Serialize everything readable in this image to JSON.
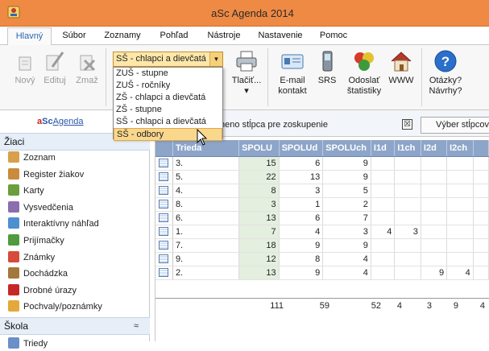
{
  "window": {
    "title": "aSc Agenda 2014"
  },
  "menu": {
    "tabs": [
      {
        "label": "Hlavný",
        "active": true
      },
      {
        "label": "Súbor"
      },
      {
        "label": "Zoznamy"
      },
      {
        "label": "Pohľad"
      },
      {
        "label": "Nástroje"
      },
      {
        "label": "Nastavenie"
      },
      {
        "label": "Pomoc"
      }
    ]
  },
  "ribbon": {
    "new_label": "Nový",
    "edit_label": "Edituj",
    "delete_label": "Zmaž",
    "print_label": "Tlačiť...",
    "print_arrow": "▾",
    "email_label_1": "E-mail",
    "email_label_2": "kontakt",
    "srs_label": "SRS",
    "stats_label_1": "Odoslať",
    "stats_label_2": "štatistiky",
    "www_label": "WWW",
    "help_label_1": "Otázky?",
    "help_label_2": "Návrhy?"
  },
  "combo": {
    "selected": "SŠ - chlapci a dievčatá",
    "options": [
      "ZUŠ - stupne",
      "ZUŠ - ročníky",
      "ZŠ - chlapci a dievčatá",
      "ZŠ - stupne",
      "SŠ - chlapci a dievčatá",
      "SŠ - odbory"
    ],
    "highlighted_index": 5
  },
  "left_panel": {
    "logo_a": "a",
    "logo_sc": "Sc",
    "logo_agenda": "Agenda",
    "section_ziaci": "Žiaci",
    "collapse_symbol": "≈",
    "items": [
      {
        "label": "Zoznam",
        "icon": "people-icon",
        "color": "#d8a04a"
      },
      {
        "label": "Register žiakov",
        "icon": "register-icon",
        "color": "#c98c3c"
      },
      {
        "label": "Karty",
        "icon": "cards-icon",
        "color": "#6b9e3c"
      },
      {
        "label": "Vysvedčenia",
        "icon": "certificate-icon",
        "color": "#8a6fb0"
      },
      {
        "label": "Interaktívny náhľad",
        "icon": "preview-icon",
        "color": "#4e8fcf"
      },
      {
        "label": "Prijímačky",
        "icon": "admission-icon",
        "color": "#4f9b3e"
      },
      {
        "label": "Známky",
        "icon": "grades-icon",
        "color": "#d64b3b"
      },
      {
        "label": "Dochádzka",
        "icon": "attendance-icon",
        "color": "#a3783a"
      },
      {
        "label": "Drobné úrazy",
        "icon": "injury-icon",
        "color": "#c62828"
      },
      {
        "label": "Pochvaly/poznámky",
        "icon": "praise-icon",
        "color": "#e3a93a"
      }
    ],
    "section_skola": "Škola",
    "partial_item": "Triedy"
  },
  "grid_toolbar": {
    "group_text": "meno stĺpca pre zoskupenie",
    "checkbox_mark": "☒",
    "column_select_label": "Výber stĺpcov"
  },
  "table": {
    "columns": [
      "Trieda",
      "SPOLU",
      "SPOLUd",
      "SPOLUch",
      "I1d",
      "I1ch",
      "I2d",
      "I2ch",
      ""
    ],
    "rows": [
      [
        "3.",
        "15",
        "6",
        "9",
        "",
        "",
        "",
        "",
        ""
      ],
      [
        "5.",
        "22",
        "13",
        "9",
        "",
        "",
        "",
        "",
        ""
      ],
      [
        "4.",
        "8",
        "3",
        "5",
        "",
        "",
        "",
        "",
        ""
      ],
      [
        "8.",
        "3",
        "1",
        "2",
        "",
        "",
        "",
        "",
        ""
      ],
      [
        "6.",
        "13",
        "6",
        "7",
        "",
        "",
        "",
        "",
        ""
      ],
      [
        "1.",
        "7",
        "4",
        "3",
        "4",
        "3",
        "",
        "",
        ""
      ],
      [
        "7.",
        "18",
        "9",
        "9",
        "",
        "",
        "",
        "",
        ""
      ],
      [
        "9.",
        "12",
        "8",
        "4",
        "",
        "",
        "",
        "",
        ""
      ],
      [
        "2.",
        "13",
        "9",
        "4",
        "",
        "",
        "9",
        "4",
        ""
      ]
    ],
    "totals": [
      "111",
      "59",
      "52",
      "4",
      "3",
      "9",
      "4"
    ]
  }
}
